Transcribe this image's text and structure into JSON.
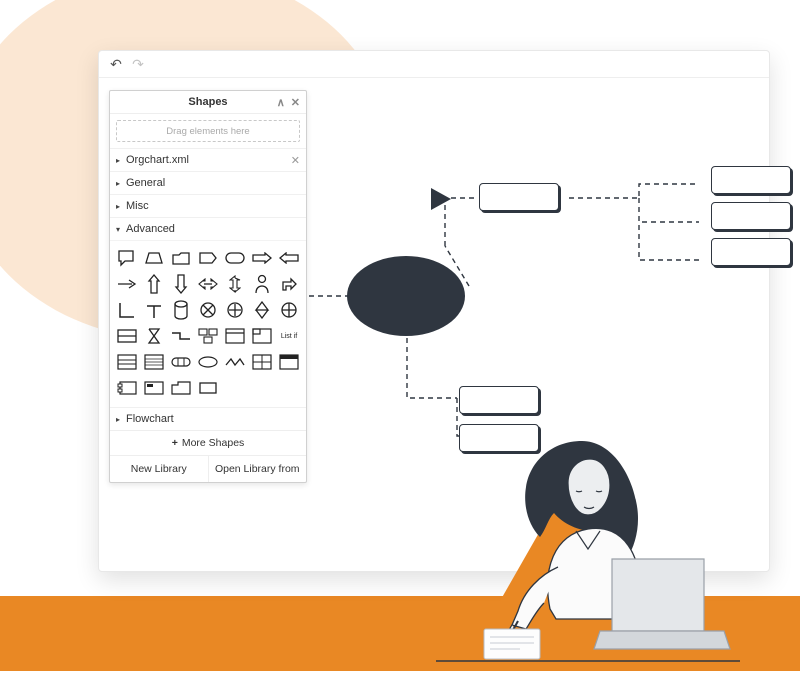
{
  "toolbar": {
    "undo_glyph": "↶",
    "redo_glyph": "↷"
  },
  "panel": {
    "title": "Shapes",
    "collapse_glyph": "∧",
    "close_glyph": "✕",
    "scratch_hint": "Drag elements here",
    "categories": {
      "orgchart": {
        "label": "Orgchart.xml",
        "closable": true
      },
      "general": {
        "label": "General"
      },
      "misc": {
        "label": "Misc"
      },
      "advanced": {
        "label": "Advanced",
        "expanded": true
      },
      "flowchart": {
        "label": "Flowchart"
      }
    },
    "more_shapes": "More Shapes",
    "plus": "+",
    "new_library": "New Library",
    "open_library": "Open Library from",
    "list_if_label": "List if"
  },
  "icons": {
    "tri_right": "▸",
    "tri_down": "▾",
    "x": "✕"
  }
}
